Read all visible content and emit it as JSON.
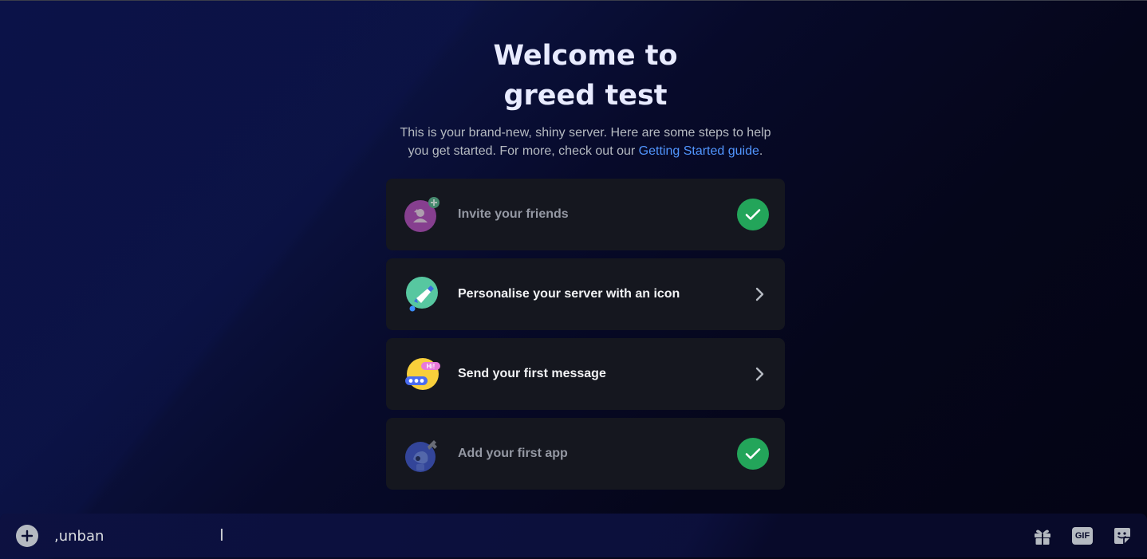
{
  "welcome": {
    "title_line1": "Welcome to",
    "title_line2": "greed test",
    "subtitle": "This is your brand-new, shiny server. Here are some steps to help you get started. For more, check out our ",
    "link_text": "Getting Started guide",
    "subtitle_end": "."
  },
  "checklist": [
    {
      "label": "Invite your friends",
      "status": "completed",
      "icon": "invite-friends-icon"
    },
    {
      "label": "Personalise your server with an icon",
      "status": "pending",
      "icon": "paint-brush-icon"
    },
    {
      "label": "Send your first message",
      "status": "pending",
      "icon": "chat-bubble-icon",
      "badge": "Hi!"
    },
    {
      "label": "Add your first app",
      "status": "completed",
      "icon": "robot-app-icon"
    }
  ],
  "composer": {
    "value": ",unban",
    "icons": [
      "add-attachment-icon",
      "gift-icon",
      "gif-icon",
      "sticker-icon"
    ],
    "gif_label": "GIF"
  },
  "colors": {
    "background": "#050618",
    "card": "#15171f",
    "accent_link": "#5196ff",
    "success": "#23a55a"
  }
}
